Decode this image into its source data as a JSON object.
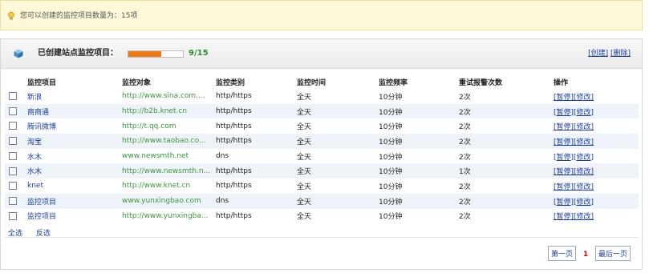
{
  "notice": {
    "text": "您可以创建的监控项目数量为：15项"
  },
  "panel": {
    "title": "已创建站点监控项目：",
    "progress": {
      "used": 9,
      "total": 15,
      "label": "9/15",
      "fraction": 0.6
    },
    "create_label": "[创建]",
    "delete_label": "[删除]"
  },
  "table": {
    "headers": [
      "",
      "监控项目",
      "监控对象",
      "监控类别",
      "监控时间",
      "监控频率",
      "重试报警次数",
      "操作"
    ],
    "rows": [
      {
        "name": "新浪",
        "target": "http://www.sina.com....",
        "type": "http/https",
        "time": "全天",
        "freq": "10分钟",
        "retry": "2次"
      },
      {
        "name": "商商通",
        "target": "http://b2b.knet.cn",
        "type": "http/https",
        "time": "全天",
        "freq": "10分钟",
        "retry": "2次"
      },
      {
        "name": "腾讯微博",
        "target": "http://t.qq.com",
        "type": "http/https",
        "time": "全天",
        "freq": "10分钟",
        "retry": "2次"
      },
      {
        "name": "淘宝",
        "target": "http://www.taobao.co...",
        "type": "http/https",
        "time": "全天",
        "freq": "10分钟",
        "retry": "2次"
      },
      {
        "name": "水木",
        "target": "www.newsmth.net",
        "type": "dns",
        "time": "全天",
        "freq": "10分钟",
        "retry": "2次"
      },
      {
        "name": "水木",
        "target": "http://www.newsmth.n...",
        "type": "http/https",
        "time": "全天",
        "freq": "10分钟",
        "retry": "1次"
      },
      {
        "name": "knet",
        "target": "http://www.knet.cn",
        "type": "http/https",
        "time": "全天",
        "freq": "10分钟",
        "retry": "2次"
      },
      {
        "name": "监控项目",
        "target": "www.yunxingbao.com",
        "type": "dns",
        "time": "全天",
        "freq": "10分钟",
        "retry": "2次"
      },
      {
        "name": "监控项目",
        "target": "http://www.yunxingba...",
        "type": "http/https",
        "time": "全天",
        "freq": "10分钟",
        "retry": "2次"
      }
    ],
    "pause_label": "[暂停]",
    "edit_label": "[修改]"
  },
  "selection": {
    "select_all": "全选",
    "invert": "反选"
  },
  "pager": {
    "first": "第一页",
    "current": "1",
    "last": "最后一页"
  },
  "colors": {
    "accent": "#f07a18",
    "link": "#1a3fa0",
    "url": "#3a9a3a",
    "notice_bg": "#fdf8d8"
  }
}
